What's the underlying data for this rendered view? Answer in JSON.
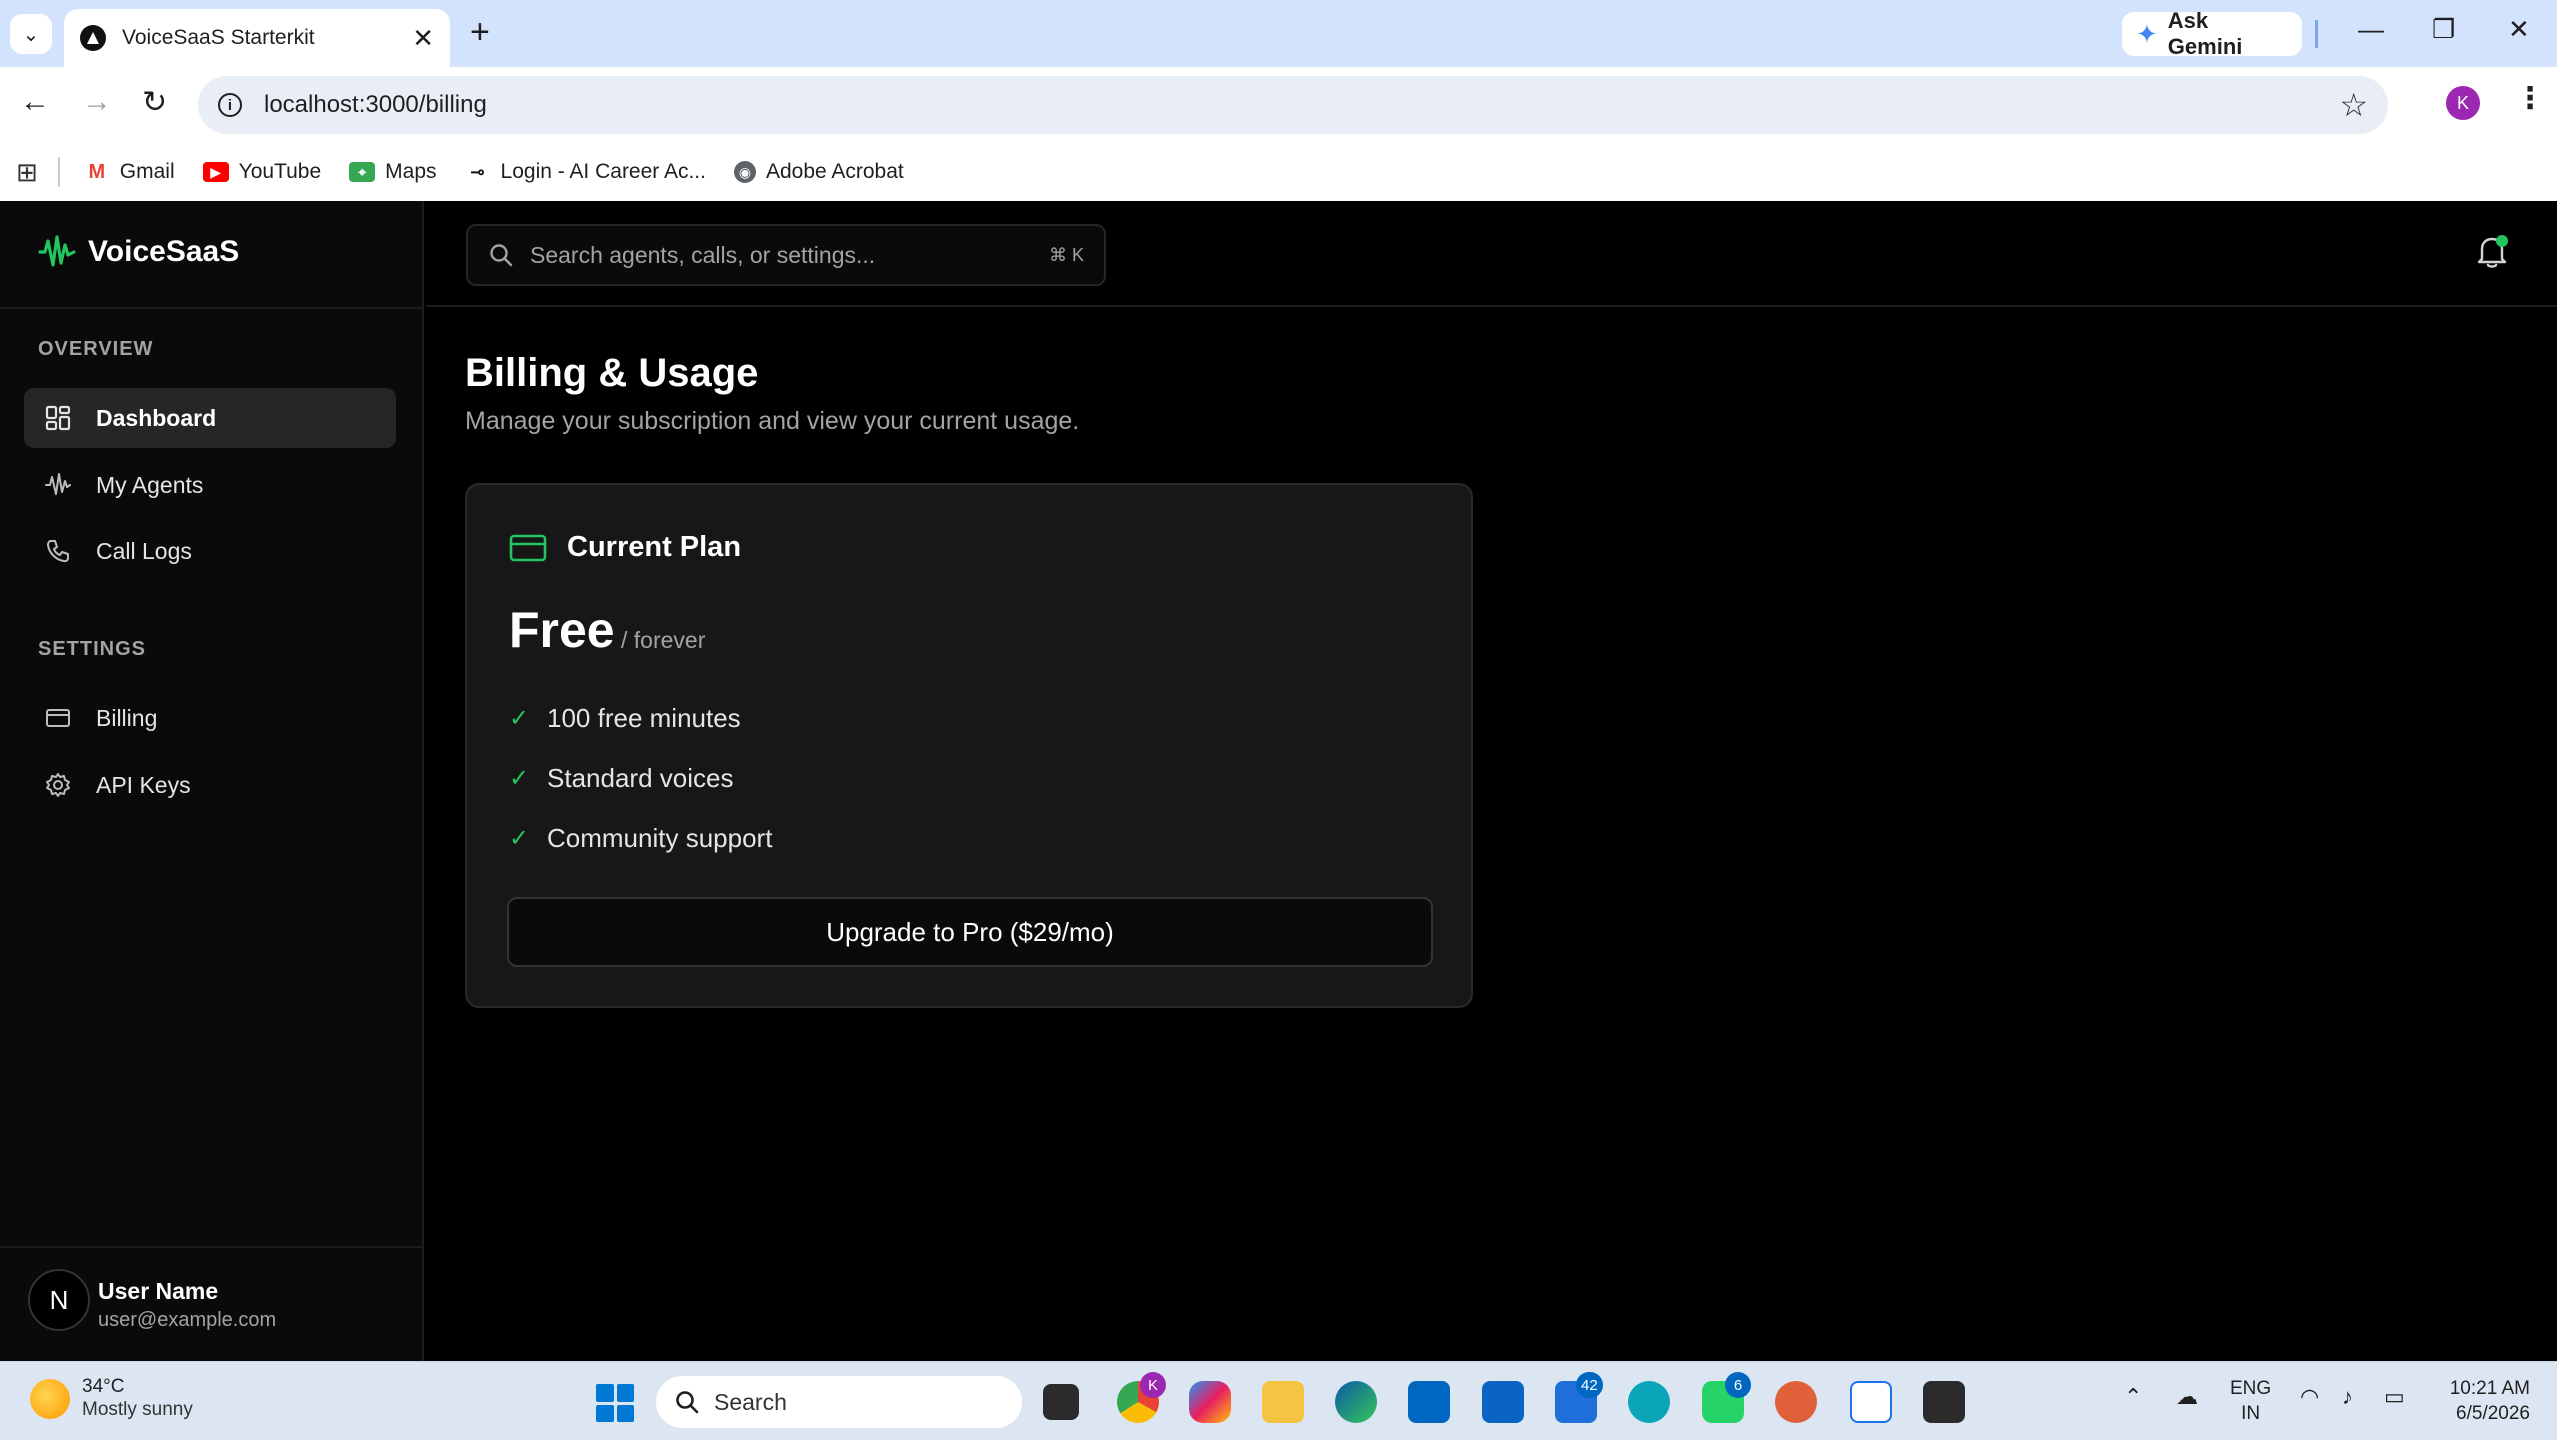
{
  "browser": {
    "tab_title": "VoiceSaaS Starterkit",
    "gemini_label": "Ask Gemini",
    "url": "localhost:3000/billing",
    "profile_initial": "K",
    "bookmarks": [
      {
        "label": "Gmail",
        "icon": "gmail-icon"
      },
      {
        "label": "YouTube",
        "icon": "youtube-icon"
      },
      {
        "label": "Maps",
        "icon": "maps-icon"
      },
      {
        "label": "Login - AI Career Ac...",
        "icon": "link-icon"
      },
      {
        "label": "Adobe Acrobat",
        "icon": "acrobat-icon"
      }
    ]
  },
  "app": {
    "brand": "VoiceSaaS",
    "accent_color": "#22c55e",
    "search_placeholder": "Search agents, calls, or settings...",
    "search_shortcut": "⌘ K",
    "sidebar": {
      "overview_heading": "OVERVIEW",
      "settings_heading": "SETTINGS",
      "items": [
        {
          "label": "Dashboard",
          "icon": "dashboard-grid-icon",
          "active": true
        },
        {
          "label": "My Agents",
          "icon": "waveform-icon"
        },
        {
          "label": "Call Logs",
          "icon": "phone-icon"
        },
        {
          "label": "Billing",
          "icon": "credit-card-icon"
        },
        {
          "label": "API Keys",
          "icon": "gear-icon"
        }
      ]
    },
    "user": {
      "initial": "N",
      "name": "User Name",
      "email": "user@example.com"
    },
    "page": {
      "title": "Billing & Usage",
      "subtitle": "Manage your subscription and view your current usage."
    },
    "plan_card": {
      "heading": "Current Plan",
      "price": "Free",
      "period": "/ forever",
      "features": [
        "100 free minutes",
        "Standard voices",
        "Community support"
      ],
      "upgrade_button": "Upgrade to Pro ($29/mo)"
    }
  },
  "taskbar": {
    "weather_temp": "34°C",
    "weather_condition": "Mostly sunny",
    "search_label": "Search",
    "badges": {
      "mail": "42",
      "whatsapp": "6",
      "chrome_profile": "K"
    },
    "lang_top": "ENG",
    "lang_bottom": "IN",
    "time": "10:21 AM",
    "date": "6/5/2026"
  }
}
